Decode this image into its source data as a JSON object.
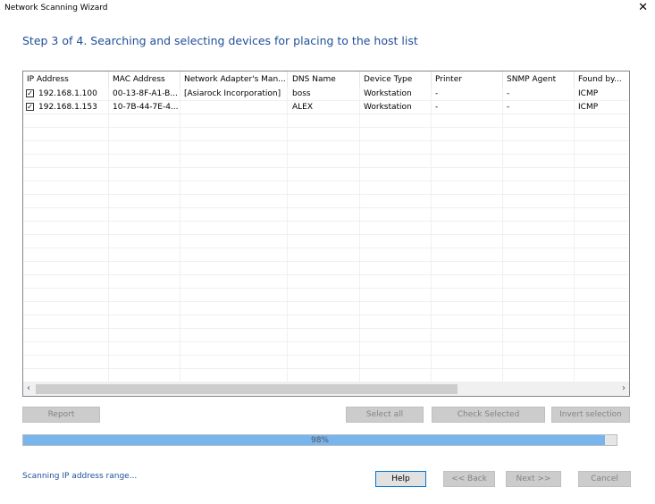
{
  "window": {
    "title": "Network Scanning Wizard",
    "close_glyph": "✕"
  },
  "heading": "Step 3 of 4. Searching and selecting devices for placing to the host list",
  "table": {
    "columns": [
      "IP Address",
      "MAC Address",
      "Network Adapter's Man...",
      "DNS Name",
      "Device Type",
      "Printer",
      "SNMP Agent",
      "Found by..."
    ],
    "rows": [
      {
        "checked": true,
        "cells": [
          "192.168.1.100",
          "00-13-8F-A1-B...",
          "[Asiarock Incorporation]",
          "boss",
          "Workstation",
          "-",
          "-",
          "ICMP"
        ]
      },
      {
        "checked": true,
        "cells": [
          "192.168.1.153",
          "10-7B-44-7E-4...",
          "",
          "ALEX",
          "Workstation",
          "-",
          "-",
          "ICMP"
        ]
      }
    ],
    "scroll_left_glyph": "‹",
    "scroll_right_glyph": "›"
  },
  "buttons": {
    "report": "Report",
    "select_all": "Select all",
    "check_selected": "Check Selected",
    "invert_selection": "Invert selection",
    "help": "Help",
    "back": "<< Back",
    "next": "Next >>",
    "cancel": "Cancel"
  },
  "progress": {
    "value": 0.98,
    "label": "98%"
  },
  "status": "Scanning IP address range...",
  "colors": {
    "heading": "#1f4e99",
    "progress_fill": "#78b4ee",
    "accent_border": "#0078d7"
  },
  "icons": {
    "checkbox": "checkbox-checked-icon",
    "close": "close-icon"
  }
}
